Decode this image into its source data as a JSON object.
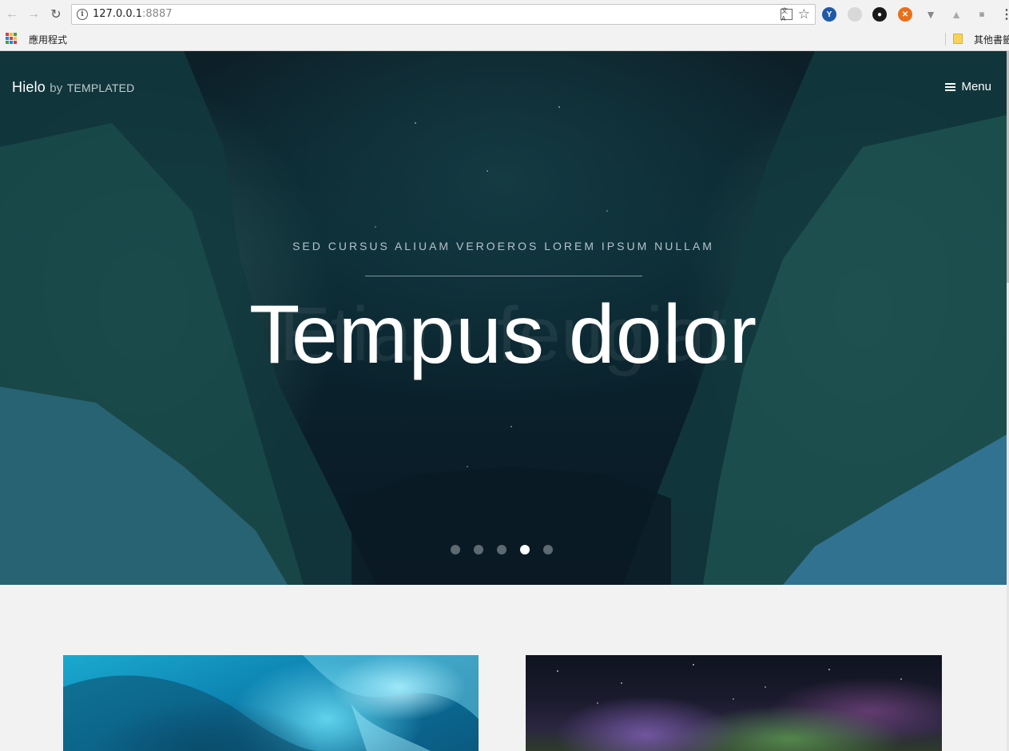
{
  "browser": {
    "url_host": "127.0.0.1",
    "url_port": ":8887",
    "info_glyph": "i",
    "translate_glyph": "文A",
    "bookmarks_bar": {
      "apps_label": "應用程式",
      "other_bookmarks_label": "其他書籤"
    },
    "extensions": [
      "vivaldi-extension-icon",
      "cloud-extension-icon",
      "ghost-extension-icon",
      "orange-extension-icon",
      "v-extension-icon",
      "drive-extension-icon",
      "smart-extension-icon"
    ]
  },
  "site": {
    "logo_name": "Hielo",
    "logo_by": "by",
    "logo_brand": "TEMPLATED",
    "menu_label": "Menu"
  },
  "hero": {
    "kicker": "SED CURSUS ALIUAM VEROEROS LOREM IPSUM NULLAM",
    "title": "Tempus dolor",
    "ghost_title": "Etiam feugiat",
    "slides_total": 5,
    "active_slide": 4
  },
  "cards": [
    {
      "image": "ice-cave-image"
    },
    {
      "image": "aurora-image"
    }
  ],
  "colors": {
    "page_background": "#f2f2f2",
    "hero_tint": "#0a2a33",
    "dot_active": "#ffffff",
    "dot_inactive": "#96a0a5"
  }
}
